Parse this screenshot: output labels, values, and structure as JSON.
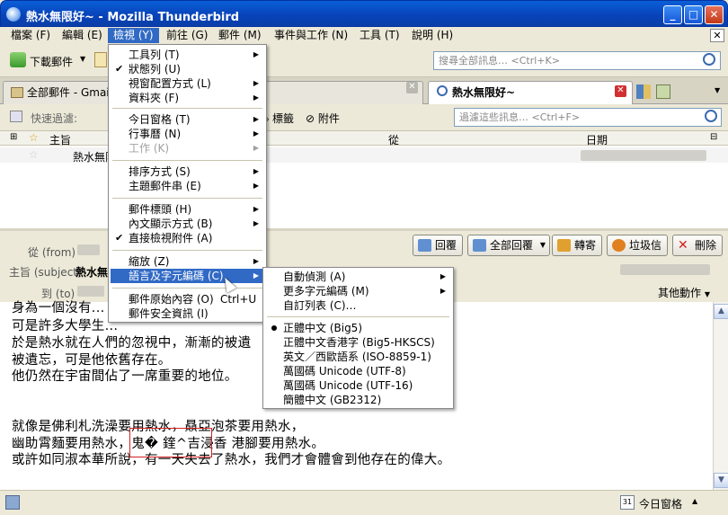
{
  "window": {
    "title": "熱水無限好~ - Mozilla Thunderbird",
    "min": "_",
    "max": "□",
    "close": "✕"
  },
  "menubar": [
    {
      "label": "檔案 (F)"
    },
    {
      "label": "編輯 (E)"
    },
    {
      "label": "檢視 (Y)"
    },
    {
      "label": "前往 (G)"
    },
    {
      "label": "郵件 (M)"
    },
    {
      "label": "事件與工作 (N)"
    },
    {
      "label": "工具 (T)"
    },
    {
      "label": "說明 (H)"
    }
  ],
  "toolbar": {
    "get_mail": "下載郵件",
    "search_placeholder": "搜尋全部訊息… <Ctrl+K>"
  },
  "tabs": [
    {
      "label": "全部郵件 - Gmail"
    },
    {
      "label": "熱水無限好~"
    }
  ],
  "quickfilter": {
    "label": "快速過濾:",
    "tags": "標籤",
    "attach": "附件",
    "placeholder": "過濾這些訊息… <Ctrl+F>"
  },
  "columns": {
    "subject": "主旨",
    "from": "從",
    "date": "日期"
  },
  "thread_row": {
    "subject": "熱水無限好~"
  },
  "header": {
    "from_label": "從 (from)",
    "subject_label": "主旨 (subject)",
    "to_label": "到 (to)",
    "subject_value": "熱水無",
    "reply": "回覆",
    "reply_all": "全部回覆",
    "forward": "轉寄",
    "junk": "垃圾信",
    "delete": "刪除",
    "other": "其他動作"
  },
  "body": {
    "lines": [
      "身為一個沒有...",
      "可是許多大學生...",
      "於是熱水就在人們的忽視中，漸漸的被遺",
      "被遺忘，可是他依舊存在。",
      "他仍然在宇宙間佔了一席重要的地位。",
      "",
      "就像是佛利札洗澡要用熱水，贔亞泡茶要用熱水，",
      "幽助霄麵要用熱水，鬼� 鍷^吉浸香 港腳要用熱水。",
      "或許如同淑本華所說，有一天失去了熱水，我們才會體會到他存在的偉大。"
    ]
  },
  "status": {
    "today": "今日窗格"
  },
  "view_menu": {
    "items": [
      {
        "label": "工具列 (T)",
        "sub": true
      },
      {
        "label": "狀態列 (U)",
        "check": true
      },
      {
        "label": "視窗配置方式 (L)",
        "sub": true
      },
      {
        "label": "資料夾 (F)",
        "sub": true
      },
      {
        "sep": true
      },
      {
        "label": "今日窗格 (T)",
        "sub": true
      },
      {
        "label": "行事曆 (N)",
        "sub": true
      },
      {
        "label": "工作 (K)",
        "sub": true,
        "disabled": true
      },
      {
        "sep": true
      },
      {
        "label": "排序方式 (S)",
        "sub": true
      },
      {
        "label": "主題郵件串 (E)",
        "sub": true
      },
      {
        "sep": true
      },
      {
        "label": "郵件標頭 (H)",
        "sub": true
      },
      {
        "label": "內文顯示方式 (B)",
        "sub": true
      },
      {
        "label": "直接檢視附件 (A)",
        "check": true
      },
      {
        "sep": true
      },
      {
        "label": "縮放 (Z)",
        "sub": true
      },
      {
        "label": "語言及字元編碼 (C)",
        "sub": true,
        "hl": true
      },
      {
        "sep": true
      },
      {
        "label": "郵件原始內容 (O)",
        "shortcut": "Ctrl+U"
      },
      {
        "label": "郵件安全資訊 (I)"
      }
    ]
  },
  "encoding_menu": {
    "items": [
      {
        "label": "自動偵測 (A)",
        "sub": true
      },
      {
        "label": "更多字元編碼 (M)",
        "sub": true
      },
      {
        "label": "自訂列表 (C)…"
      },
      {
        "sep": true
      },
      {
        "label": "正體中文 (Big5)",
        "radio": true
      },
      {
        "label": "正體中文香港字 (Big5-HKSCS)"
      },
      {
        "label": "英文／西歐語系 (ISO-8859-1)"
      },
      {
        "label": "萬國碼 Unicode (UTF-8)"
      },
      {
        "label": "萬國碼 Unicode (UTF-16)"
      },
      {
        "label": "簡體中文 (GB2312)"
      }
    ]
  },
  "colors": {
    "titlebar": "#0842b8",
    "highlight": "#316ac5",
    "red_box": "#d42020"
  }
}
